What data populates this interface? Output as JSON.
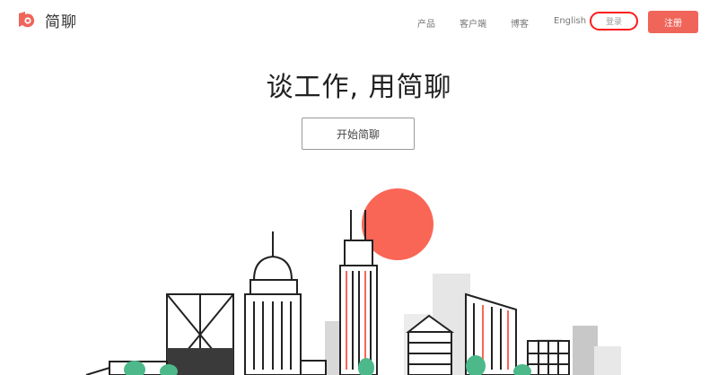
{
  "brand": {
    "name": "简聊",
    "accent": "#f0655a"
  },
  "nav": {
    "products": "产品",
    "client": "客户端",
    "blog": "博客",
    "english": "English",
    "login": "登录",
    "signup": "注册"
  },
  "hero": {
    "title": "谈工作, 用简聊",
    "cta": "开始简聊"
  },
  "illustration": {
    "name": "city-skyline-illustration",
    "sun_color": "#fa6656"
  }
}
